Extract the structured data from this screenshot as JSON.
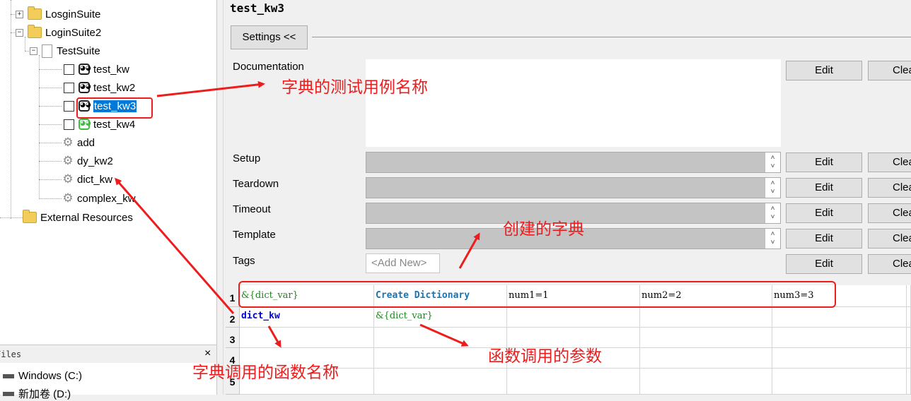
{
  "tree": {
    "nodes": [
      {
        "label": "LosginSuite"
      },
      {
        "label": "LoginSuite2"
      },
      {
        "label": "TestSuite"
      },
      {
        "label": "test_kw"
      },
      {
        "label": "test_kw2"
      },
      {
        "label": "test_kw3"
      },
      {
        "label": "test_kw4"
      },
      {
        "label": "add"
      },
      {
        "label": "dy_kw2"
      },
      {
        "label": "dict_kw"
      },
      {
        "label": "complex_kw"
      },
      {
        "label": "External Resources"
      }
    ]
  },
  "files_panel": {
    "title": "Files",
    "close": "×",
    "drives": [
      "Windows (C:)",
      "新加卷 (D:)"
    ]
  },
  "editor": {
    "title": "test_kw3",
    "settings_button": "Settings <<",
    "labels": {
      "documentation": "Documentation",
      "setup": "Setup",
      "teardown": "Teardown",
      "timeout": "Timeout",
      "template": "Template",
      "tags": "Tags"
    },
    "edit_label": "Edit",
    "clear_label": "Clea",
    "add_new_tag": "<Add New>"
  },
  "grid": {
    "rows": [
      {
        "num": "1",
        "cells": [
          "&{dict_var}",
          "Create Dictionary",
          "num1=1",
          "num2=2",
          "num3=3"
        ]
      },
      {
        "num": "2",
        "cells": [
          "dict_kw",
          "&{dict_var}",
          "",
          "",
          ""
        ]
      },
      {
        "num": "3",
        "cells": [
          "",
          "",
          "",
          "",
          ""
        ]
      },
      {
        "num": "4",
        "cells": [
          "",
          "",
          "",
          "",
          ""
        ]
      },
      {
        "num": "5",
        "cells": [
          "",
          "",
          "",
          "",
          ""
        ]
      }
    ]
  },
  "annotations": {
    "testcase_name": "字典的测试用例名称",
    "created_dict": "创建的字典",
    "call_args": "函数调用的参数",
    "called_func": "字典调用的函数名称",
    "color": "#ee1c1c"
  }
}
